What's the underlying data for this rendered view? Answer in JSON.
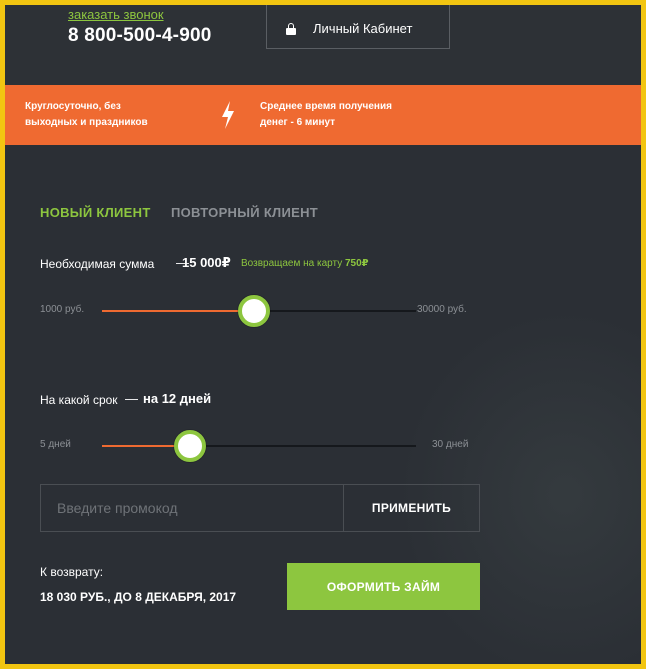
{
  "header": {
    "callback_link": "заказать звонок",
    "phone": "8 800-500-4-900",
    "cabinet_button": "Личный Кабинет"
  },
  "band": {
    "left_line1": "Круглосуточно, без",
    "left_line2": "выходных и праздников",
    "right_line1": "Среднее время получения",
    "right_line2": "денег - 6 минут"
  },
  "tabs": {
    "new_client": "НОВЫЙ КЛИЕНТ",
    "repeat_client": "ПОВТОРНЫЙ КЛИЕНТ",
    "active": "new_client"
  },
  "amount": {
    "label": "Необходимая сумма",
    "dash": "—",
    "value": "15 000₽",
    "cashback_prefix": "Возвращаем на карту",
    "cashback_value": "750₽",
    "min_label": "1000 руб.",
    "max_label": "30000 руб.",
    "min": 1000,
    "max": 30000,
    "current": 15000
  },
  "term": {
    "label": "На какой срок",
    "dash": "—",
    "value": "на 12 дней",
    "min_label": "5 дней",
    "max_label": "30 дней",
    "min": 5,
    "max": 30,
    "current": 12
  },
  "promo": {
    "placeholder": "Введите промокод",
    "value": "",
    "apply_button": "ПРИМЕНИТЬ"
  },
  "summary": {
    "return_label": "К возврату:",
    "return_value": "18 030 РУБ., ДО 8 ДЕКАБРЯ, 2017",
    "submit_button": "ОФОРМИТЬ ЗАЙМ"
  },
  "colors": {
    "accent_green": "#8dc63f",
    "accent_orange": "#ef6a31",
    "background": "#2b2f35",
    "border_yellow": "#f2c511"
  },
  "icons": {
    "cabinet": "lock-icon",
    "band": "lightning-bolt-icon"
  }
}
